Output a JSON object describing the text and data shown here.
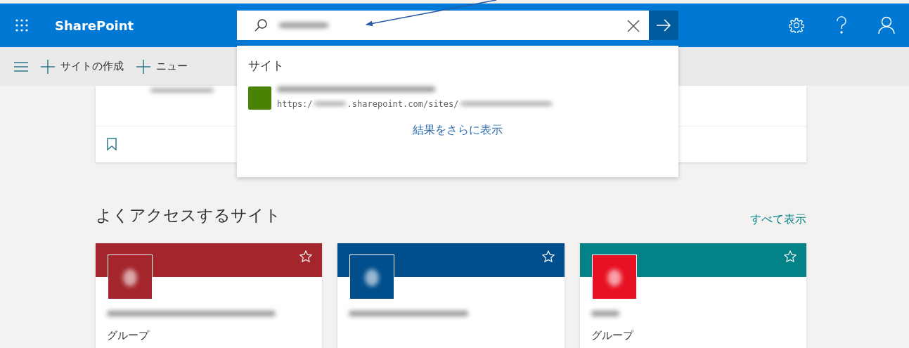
{
  "app": {
    "name": "SharePoint"
  },
  "commands": [
    {
      "label": "サイトの作成"
    },
    {
      "label": "ニュー"
    }
  ],
  "search": {
    "results_heading": "サイト",
    "results": [
      {
        "url_parts": [
          "https:/",
          ".sharepoint.com/sites/"
        ],
        "color": "#498205"
      }
    ],
    "more_link": "結果をさらに表示"
  },
  "frequent_sites": {
    "title": "よくアクセスするサイト",
    "see_all": "すべて表示",
    "sites": [
      {
        "color": "#a4262c",
        "logo": {
          "color": "#a4262c"
        },
        "favorite": false,
        "type": "グループ"
      },
      {
        "color": "#004e8c",
        "logo": {
          "color": "#004e8c"
        },
        "favorite": false
      },
      {
        "color": "#038387",
        "logo": {
          "color": "#e81123"
        },
        "favorite": false,
        "type": "グループ"
      }
    ]
  }
}
